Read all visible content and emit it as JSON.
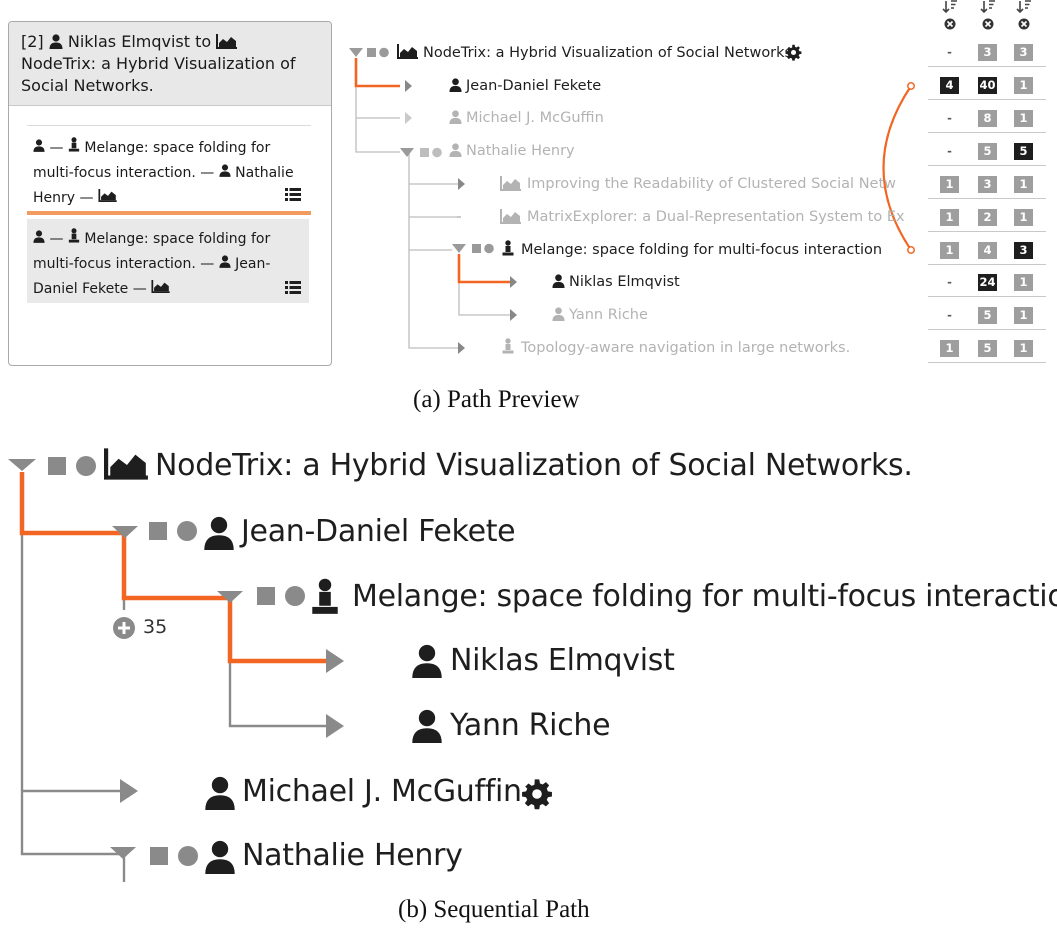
{
  "popup": {
    "header_line1_prefix": "[2]",
    "header_line1_name": "Niklas Elmqvist to",
    "header_line2": "NodeTrix: a Hybrid Visualization of",
    "header_line3": "Social Networks.",
    "items": [
      {
        "line1": "—",
        "line1b": "Melange: space folding for",
        "line2": "multi-focus interaction. —",
        "line2b": "Nathalie",
        "line3": "Henry —"
      },
      {
        "line1": "—",
        "line1b": "Melange: space folding for",
        "line2": "multi-focus interaction. —",
        "line2b": "Jean-",
        "line3": "Daniel Fekete —"
      }
    ]
  },
  "tree_a": {
    "nodes": [
      {
        "label": "NodeTrix: a Hybrid Visualization of Social Networks.",
        "icon": "chart-icon",
        "state": "active"
      },
      {
        "label": "Jean-Daniel Fekete",
        "icon": "person-icon",
        "state": "active"
      },
      {
        "label": "Michael J. McGuffin",
        "icon": "person-icon",
        "state": "dim"
      },
      {
        "label": "Nathalie Henry",
        "icon": "person-icon",
        "state": "dim"
      },
      {
        "label": "Improving the Readability of Clustered Social Netw",
        "icon": "chart-icon",
        "state": "dim"
      },
      {
        "label": "MatrixExplorer: a Dual-Representation System to Ex",
        "icon": "chart-icon",
        "state": "dim"
      },
      {
        "label": "Melange: space folding for multi-focus interaction",
        "icon": "presenter-icon",
        "state": "active"
      },
      {
        "label": "Niklas Elmqvist",
        "icon": "person-icon",
        "state": "active"
      },
      {
        "label": "Yann Riche",
        "icon": "person-icon",
        "state": "dim"
      },
      {
        "label": "Topology-aware navigation in large networks.",
        "icon": "presenter-icon",
        "state": "dim"
      }
    ],
    "columns": [
      [
        "-",
        "4",
        "-",
        "-",
        "1",
        "1",
        "1",
        "-",
        "-",
        "1"
      ],
      [
        "3",
        "40",
        "8",
        "5",
        "3",
        "2",
        "4",
        "24",
        "5",
        "5"
      ],
      [
        "3",
        "1",
        "1",
        "5",
        "1",
        "1",
        "3",
        "1",
        "1",
        "1"
      ]
    ],
    "column_styles": [
      [
        "dash",
        "black",
        "dash",
        "dash",
        "grey",
        "grey",
        "grey",
        "dash",
        "dash",
        "grey"
      ],
      [
        "grey",
        "black",
        "grey",
        "grey",
        "grey",
        "grey",
        "grey",
        "black",
        "grey",
        "grey"
      ],
      [
        "grey",
        "grey",
        "grey",
        "black",
        "grey",
        "grey",
        "black",
        "grey",
        "grey",
        "grey"
      ]
    ]
  },
  "caption_a": "(a)  Path Preview",
  "tree_b": {
    "nodes": [
      {
        "label": "NodeTrix: a Hybrid Visualization of Social Networks."
      },
      {
        "label": "Jean-Daniel Fekete"
      },
      {
        "label": "Melange: space folding for multi-focus interaction"
      },
      {
        "label": "Niklas Elmqvist"
      },
      {
        "label": "Yann Riche"
      },
      {
        "label": "Michael J. McGuffin"
      },
      {
        "label": "Nathalie Henry"
      }
    ],
    "collapsed_count": "35"
  },
  "caption_b": "(b)  Sequential Path",
  "colors": {
    "path": "#f26522",
    "tree_line": "#9a9a9a",
    "dark": "#1e1e1e",
    "dim": "#b3b3b3"
  }
}
